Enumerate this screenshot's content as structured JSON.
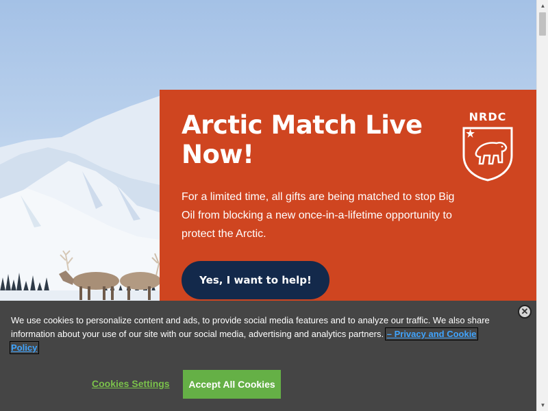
{
  "promo": {
    "title": "Arctic Match Live Now!",
    "body": "For a limited time, all gifts are being matched to stop Big Oil from blocking a new once-in-a-lifetime opportunity to protect the Arctic.",
    "cta_label": "Yes, I want to help!",
    "logo_text": "NRDC",
    "background_color": "#cf4520",
    "cta_color": "#13294b"
  },
  "cookie_banner": {
    "text": "We use cookies to personalize content and ads, to provide social media features and to analyze our traffic. We also share information about your use of our site with our social media, advertising and analytics partners.",
    "policy_link_label": "– Privacy and Cookie Policy",
    "settings_label": "Cookies Settings",
    "accept_label": "Accept All Cookies",
    "close_symbol": "✕",
    "background_color": "#454545",
    "accent_color": "#65b046"
  },
  "scrollbar": {
    "up_arrow": "▲",
    "down_arrow": "▼"
  },
  "icons": {
    "logo": "nrdc-polar-bear-shield-icon",
    "close": "close-icon"
  }
}
